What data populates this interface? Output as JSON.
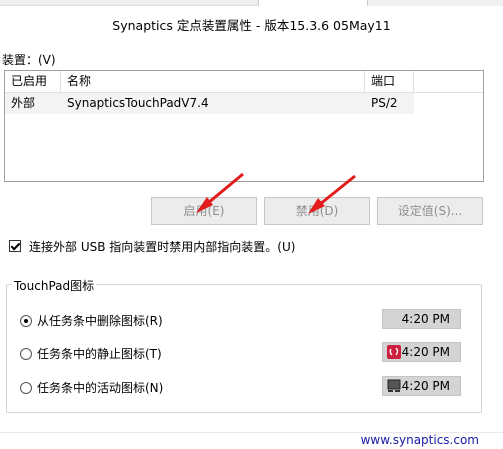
{
  "window": {
    "title": "Synaptics 定点装置属性 - 版本15.3.6 05May11"
  },
  "devices": {
    "label": "装置：(V)",
    "columns": [
      "已启用",
      "名称",
      "端口"
    ],
    "rows": [
      {
        "enabled": "外部",
        "name": "SynapticsTouchPadV7.4",
        "port": "PS/2"
      }
    ]
  },
  "buttons": {
    "enable": "启用(E)",
    "disable": "禁用(D)",
    "settings": "设定值(S)..."
  },
  "disable_internal": {
    "label": "连接外部 USB 指向装置时禁用内部指向装置。(U)",
    "checked": true
  },
  "tray_group": {
    "title": "TouchPad图标",
    "options": [
      {
        "label": "从任务条中删除图标(R)",
        "selected": true,
        "time": "4:20 PM",
        "icon": "none"
      },
      {
        "label": "任务条中的静止图标(T)",
        "selected": false,
        "time": "4:20 PM",
        "icon": "synaptics-touchpad-icon"
      },
      {
        "label": "任务条中的活动图标(N)",
        "selected": false,
        "time": "4:20 PM",
        "icon": "touchpad-activity-icon"
      }
    ]
  },
  "footer": {
    "link": "www.synaptics.com"
  },
  "colors": {
    "arrow": "#e21b1b",
    "link": "#1a1aa6",
    "disabled_text": "#8f8f8f",
    "tray_bg": "#d4d4d4",
    "synaptics_red": "#cc1f3d"
  }
}
